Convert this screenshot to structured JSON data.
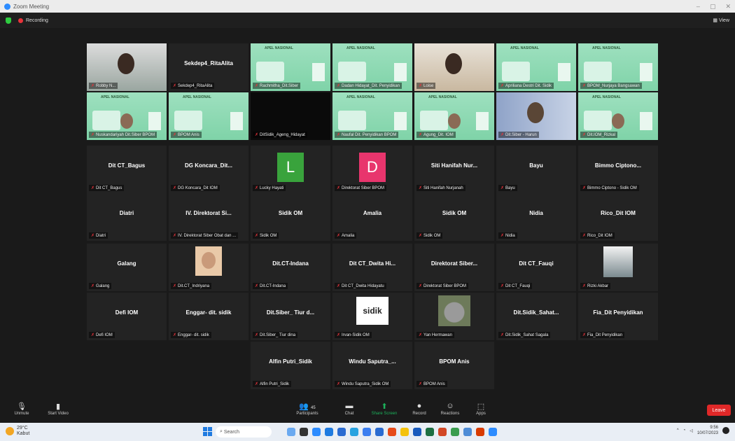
{
  "window": {
    "title": "Zoom Meeting"
  },
  "meeting": {
    "recording_label": "Recording",
    "view_label": "View"
  },
  "tiles": [
    {
      "label": "Robby N...",
      "name": ""
    },
    {
      "label": "Sekdep4_RitaAlita",
      "name": "Sekdep4_RitaAlita"
    },
    {
      "label": "Rachmitha_Dit.Siber",
      "name": ""
    },
    {
      "label": "Dadan Hidayat_Dit. Penyidikan",
      "name": ""
    },
    {
      "label": "Loise",
      "name": ""
    },
    {
      "label": "Apriliana Destri Dit. Sidik",
      "name": ""
    },
    {
      "label": "BPOM_Nurjaya Bangsawan",
      "name": ""
    },
    {
      "label": "Nuskandariyah Dit.Siber BPOM",
      "name": ""
    },
    {
      "label": "BPOM Anis",
      "name": ""
    },
    {
      "label": "DitSidik_Ageng_Hidayat",
      "name": ""
    },
    {
      "label": "Naufal Dit. Penyidikan BPOM",
      "name": ""
    },
    {
      "label": "Agung_Dit. IOM",
      "name": ""
    },
    {
      "label": "Dit.Siber - Harun",
      "name": ""
    },
    {
      "label": "Dit.IOM_Rizkal",
      "name": ""
    },
    {
      "label": "Dit CT_Bagus",
      "name": "Dit CT_Bagus"
    },
    {
      "label": "DG Koncara_Dit IOM",
      "name": "DG Koncara_Dit..."
    },
    {
      "label": "Lucky Hayati",
      "name": "L"
    },
    {
      "label": "Direktorat Siber BPOM",
      "name": "D"
    },
    {
      "label": "Siti Hanifah Nurjanah",
      "name": "Siti Hanifah Nur..."
    },
    {
      "label": "Bayu",
      "name": "Bayu"
    },
    {
      "label": "Bimmo Ciptono - Sidik OM",
      "name": "Bimmo Ciptono..."
    },
    {
      "label": "Diatri",
      "name": "Diatri"
    },
    {
      "label": "IV. Direktorat Siber Obat dan ...",
      "name": "IV. Direktorat Si..."
    },
    {
      "label": "Sidik OM",
      "name": "Sidik OM"
    },
    {
      "label": "Amalia",
      "name": "Amalia"
    },
    {
      "label": "Sidik OM",
      "name": "Sidik OM"
    },
    {
      "label": "Nidia",
      "name": "Nidia"
    },
    {
      "label": "Rico_Dit IOM",
      "name": "Rico_Dit IOM"
    },
    {
      "label": "Galang",
      "name": "Galang"
    },
    {
      "label": "Dit.CT_Indriyana",
      "name": ""
    },
    {
      "label": "Dit.CT-Indana",
      "name": "Dit.CT-Indana"
    },
    {
      "label": "Dit CT_Dwita Hidayatu",
      "name": "Dit CT_Dwita Hi..."
    },
    {
      "label": "Direktorat Siber BPOM",
      "name": "Direktorat Siber..."
    },
    {
      "label": "Dit CT_Fauqi",
      "name": "Dit CT_Fauqi"
    },
    {
      "label": "Rizki Akbar",
      "name": ""
    },
    {
      "label": "Defi IOM",
      "name": "Defi IOM"
    },
    {
      "label": "Enggar- dit. sidik",
      "name": "Enggar- dit. sidik"
    },
    {
      "label": "Dit.Siber_ Tiur dina",
      "name": "Dit.Siber_ Tiur d..."
    },
    {
      "label": "Irvan-Sidik OM",
      "name": ""
    },
    {
      "label": "Yan Hermawan",
      "name": ""
    },
    {
      "label": "Dit.Sidik_Sahat Sagala",
      "name": "Dit.Sidik_Sahat..."
    },
    {
      "label": "Fia_Dit Penyidikan",
      "name": "Fia_Dit Penyidikan"
    },
    {
      "label": "Alfin Putri_Sidik",
      "name": "Alfin Putri_Sidik"
    },
    {
      "label": "Windu Saputra_Sidik OM",
      "name": "Windu Saputra_..."
    },
    {
      "label": "BPOM Anis",
      "name": "BPOM Anis"
    }
  ],
  "poster": {
    "heading": "APEL NASIONAL"
  },
  "logo_text": "sidik",
  "controls": {
    "unmute": "Unmute",
    "start_video": "Start Video",
    "participants": "Participants",
    "participants_count": "45",
    "chat": "Chat",
    "share_screen": "Share Screen",
    "record": "Record",
    "reactions": "Reactions",
    "apps": "Apps",
    "leave": "Leave"
  },
  "taskbar": {
    "temp": "29°C",
    "weather": "Kabut",
    "search": "Search",
    "time": "9:56",
    "date": "10/07/2023"
  },
  "colors": {
    "accent": "#2d8cff",
    "leave": "#e02828",
    "speaker": "#5cd65c",
    "share": "#1cb15b"
  }
}
